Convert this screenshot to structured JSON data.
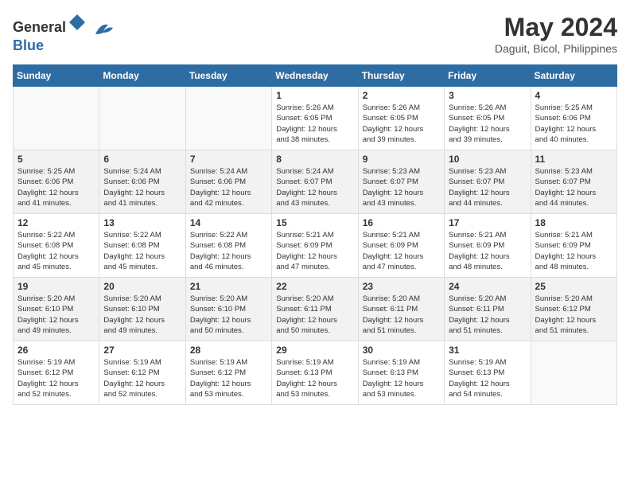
{
  "header": {
    "logo_general": "General",
    "logo_blue": "Blue",
    "month_year": "May 2024",
    "location": "Daguit, Bicol, Philippines"
  },
  "weekdays": [
    "Sunday",
    "Monday",
    "Tuesday",
    "Wednesday",
    "Thursday",
    "Friday",
    "Saturday"
  ],
  "weeks": [
    [
      {
        "day": "",
        "info": ""
      },
      {
        "day": "",
        "info": ""
      },
      {
        "day": "",
        "info": ""
      },
      {
        "day": "1",
        "info": "Sunrise: 5:26 AM\nSunset: 6:05 PM\nDaylight: 12 hours\nand 38 minutes."
      },
      {
        "day": "2",
        "info": "Sunrise: 5:26 AM\nSunset: 6:05 PM\nDaylight: 12 hours\nand 39 minutes."
      },
      {
        "day": "3",
        "info": "Sunrise: 5:26 AM\nSunset: 6:05 PM\nDaylight: 12 hours\nand 39 minutes."
      },
      {
        "day": "4",
        "info": "Sunrise: 5:25 AM\nSunset: 6:06 PM\nDaylight: 12 hours\nand 40 minutes."
      }
    ],
    [
      {
        "day": "5",
        "info": "Sunrise: 5:25 AM\nSunset: 6:06 PM\nDaylight: 12 hours\nand 41 minutes."
      },
      {
        "day": "6",
        "info": "Sunrise: 5:24 AM\nSunset: 6:06 PM\nDaylight: 12 hours\nand 41 minutes."
      },
      {
        "day": "7",
        "info": "Sunrise: 5:24 AM\nSunset: 6:06 PM\nDaylight: 12 hours\nand 42 minutes."
      },
      {
        "day": "8",
        "info": "Sunrise: 5:24 AM\nSunset: 6:07 PM\nDaylight: 12 hours\nand 43 minutes."
      },
      {
        "day": "9",
        "info": "Sunrise: 5:23 AM\nSunset: 6:07 PM\nDaylight: 12 hours\nand 43 minutes."
      },
      {
        "day": "10",
        "info": "Sunrise: 5:23 AM\nSunset: 6:07 PM\nDaylight: 12 hours\nand 44 minutes."
      },
      {
        "day": "11",
        "info": "Sunrise: 5:23 AM\nSunset: 6:07 PM\nDaylight: 12 hours\nand 44 minutes."
      }
    ],
    [
      {
        "day": "12",
        "info": "Sunrise: 5:22 AM\nSunset: 6:08 PM\nDaylight: 12 hours\nand 45 minutes."
      },
      {
        "day": "13",
        "info": "Sunrise: 5:22 AM\nSunset: 6:08 PM\nDaylight: 12 hours\nand 45 minutes."
      },
      {
        "day": "14",
        "info": "Sunrise: 5:22 AM\nSunset: 6:08 PM\nDaylight: 12 hours\nand 46 minutes."
      },
      {
        "day": "15",
        "info": "Sunrise: 5:21 AM\nSunset: 6:09 PM\nDaylight: 12 hours\nand 47 minutes."
      },
      {
        "day": "16",
        "info": "Sunrise: 5:21 AM\nSunset: 6:09 PM\nDaylight: 12 hours\nand 47 minutes."
      },
      {
        "day": "17",
        "info": "Sunrise: 5:21 AM\nSunset: 6:09 PM\nDaylight: 12 hours\nand 48 minutes."
      },
      {
        "day": "18",
        "info": "Sunrise: 5:21 AM\nSunset: 6:09 PM\nDaylight: 12 hours\nand 48 minutes."
      }
    ],
    [
      {
        "day": "19",
        "info": "Sunrise: 5:20 AM\nSunset: 6:10 PM\nDaylight: 12 hours\nand 49 minutes."
      },
      {
        "day": "20",
        "info": "Sunrise: 5:20 AM\nSunset: 6:10 PM\nDaylight: 12 hours\nand 49 minutes."
      },
      {
        "day": "21",
        "info": "Sunrise: 5:20 AM\nSunset: 6:10 PM\nDaylight: 12 hours\nand 50 minutes."
      },
      {
        "day": "22",
        "info": "Sunrise: 5:20 AM\nSunset: 6:11 PM\nDaylight: 12 hours\nand 50 minutes."
      },
      {
        "day": "23",
        "info": "Sunrise: 5:20 AM\nSunset: 6:11 PM\nDaylight: 12 hours\nand 51 minutes."
      },
      {
        "day": "24",
        "info": "Sunrise: 5:20 AM\nSunset: 6:11 PM\nDaylight: 12 hours\nand 51 minutes."
      },
      {
        "day": "25",
        "info": "Sunrise: 5:20 AM\nSunset: 6:12 PM\nDaylight: 12 hours\nand 51 minutes."
      }
    ],
    [
      {
        "day": "26",
        "info": "Sunrise: 5:19 AM\nSunset: 6:12 PM\nDaylight: 12 hours\nand 52 minutes."
      },
      {
        "day": "27",
        "info": "Sunrise: 5:19 AM\nSunset: 6:12 PM\nDaylight: 12 hours\nand 52 minutes."
      },
      {
        "day": "28",
        "info": "Sunrise: 5:19 AM\nSunset: 6:12 PM\nDaylight: 12 hours\nand 53 minutes."
      },
      {
        "day": "29",
        "info": "Sunrise: 5:19 AM\nSunset: 6:13 PM\nDaylight: 12 hours\nand 53 minutes."
      },
      {
        "day": "30",
        "info": "Sunrise: 5:19 AM\nSunset: 6:13 PM\nDaylight: 12 hours\nand 53 minutes."
      },
      {
        "day": "31",
        "info": "Sunrise: 5:19 AM\nSunset: 6:13 PM\nDaylight: 12 hours\nand 54 minutes."
      },
      {
        "day": "",
        "info": ""
      }
    ]
  ]
}
